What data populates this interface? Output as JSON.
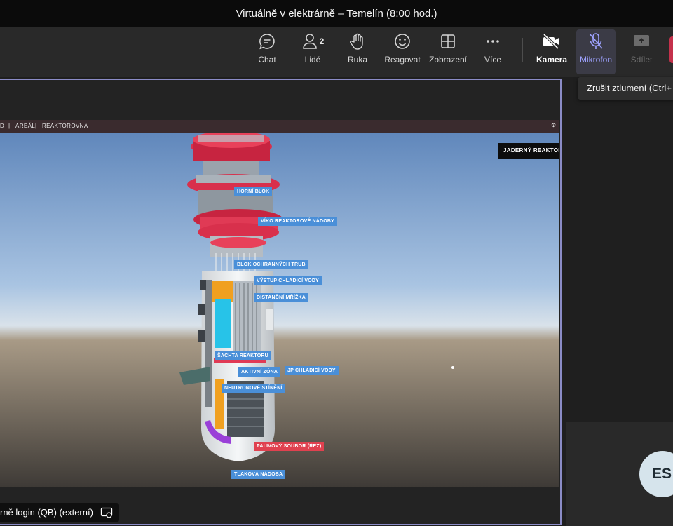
{
  "window": {
    "title": "Virtuálně v elektrárně – Temelín (8:00 hod.)"
  },
  "toolbar": {
    "chat": {
      "label": "Chat",
      "icon": "chat-icon"
    },
    "people": {
      "label": "Lidé",
      "icon": "people-icon",
      "count": "2"
    },
    "hand": {
      "label": "Ruka",
      "icon": "raise-hand-icon"
    },
    "react": {
      "label": "Reagovat",
      "icon": "smile-icon"
    },
    "view": {
      "label": "Zobrazení",
      "icon": "grid-view-icon"
    },
    "more": {
      "label": "Více",
      "icon": "more-icon"
    },
    "camera": {
      "label": "Kamera",
      "icon": "camera-off-icon"
    },
    "mic": {
      "label": "Mikrofon",
      "icon": "mic-off-icon"
    },
    "share": {
      "label": "Sdílet",
      "icon": "share-icon"
    }
  },
  "tooltip": {
    "text": "Zrušit ztlumení (Ctrl+"
  },
  "vr": {
    "breadcrumb": [
      "D",
      "AREÁL",
      "REAKTOROVNA"
    ],
    "badge": "JADERNÝ REAKTOR",
    "labels": {
      "horni_blok": "HORNÍ BLOK",
      "viko": "VÍKO REAKTOROVÉ NÁDOBY",
      "blok_trub": "BLOK OCHRANNÝCH TRUB",
      "vystup": "VÝSTUP CHLADICÍ VODY",
      "mrizka": "DISTANČNÍ MŘÍŽKA",
      "sachta": "ŠACHTA REAKTORU",
      "aktivni": "AKTIVNÍ ZÓNA",
      "jp": "JP CHLADICÍ VODY",
      "stineni": "NEUTRONOVÉ STÍNĚNÍ",
      "palivovy": "PALIVOVÝ SOUBOR (ŘEZ)",
      "nadoba": "TLAKOVÁ NÁDOBA"
    }
  },
  "presenter": {
    "name": "rně login (QB) (externí)"
  },
  "participant": {
    "initials": "ES"
  },
  "colors": {
    "accent": "#9ea2ff",
    "frame": "#8b8cc7",
    "leave": "#c4314b",
    "label_blue": "#4a8fd8",
    "label_red": "#e0414f"
  }
}
